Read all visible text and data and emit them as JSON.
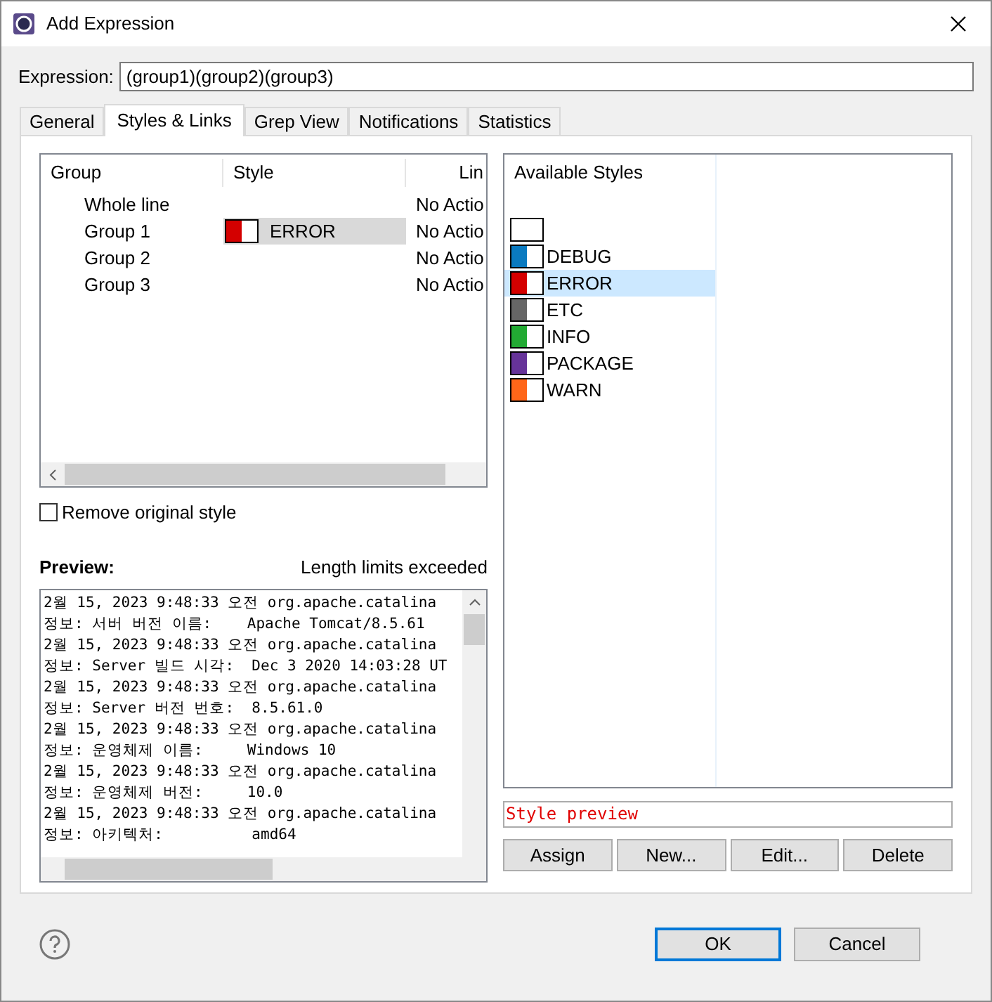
{
  "window": {
    "title": "Add Expression"
  },
  "expression": {
    "label": "Expression:",
    "value": "(group1)(group2)(group3)"
  },
  "tabs": [
    {
      "label": "General",
      "selected": false
    },
    {
      "label": "Styles & Links",
      "selected": true
    },
    {
      "label": "Grep View",
      "selected": false
    },
    {
      "label": "Notifications",
      "selected": false
    },
    {
      "label": "Statistics",
      "selected": false
    }
  ],
  "groups_table": {
    "columns": [
      "Group",
      "Style",
      "Lin"
    ],
    "rows": [
      {
        "group": "Whole line",
        "column_3": "No Actio",
        "selected": false
      },
      {
        "group": "Group 1",
        "style": {
          "name": "ERROR",
          "color": "#d40000"
        },
        "column_3": "No Actio",
        "selected": true
      },
      {
        "group": "Group 2",
        "column_3": "No Actio",
        "selected": false
      },
      {
        "group": "Group 3",
        "column_3": "No Actio",
        "selected": false
      }
    ]
  },
  "remove_original_style": {
    "label": "Remove original style",
    "checked": false
  },
  "preview": {
    "label": "Preview:",
    "status": "Length limits exceeded",
    "lines": [
      "2월 15, 2023 9:48:33 오전 org.apache.catalina",
      "정보: 서버 버전 이름:    Apache Tomcat/8.5.61",
      "2월 15, 2023 9:48:33 오전 org.apache.catalina",
      "정보: Server 빌드 시각:  Dec 3 2020 14:03:28 UT",
      "2월 15, 2023 9:48:33 오전 org.apache.catalina",
      "정보: Server 버전 번호:  8.5.61.0",
      "2월 15, 2023 9:48:33 오전 org.apache.catalina",
      "정보: 운영체제 이름:     Windows 10",
      "2월 15, 2023 9:48:33 오전 org.apache.catalina",
      "정보: 운영체제 버전:     10.0",
      "2월 15, 2023 9:48:33 오전 org.apache.catalina",
      "정보: 아키텍처:          amd64"
    ]
  },
  "available_styles": {
    "title": "Available Styles",
    "items": [
      {
        "kind": "blank",
        "selected": false
      },
      {
        "kind": "color",
        "name": "DEBUG",
        "color": "#0a7ac0",
        "selected": false
      },
      {
        "kind": "color",
        "name": "ERROR",
        "color": "#d40000",
        "selected": true
      },
      {
        "kind": "color",
        "name": "ETC",
        "color": "#666666",
        "selected": false
      },
      {
        "kind": "color",
        "name": "INFO",
        "color": "#22aa33",
        "selected": false
      },
      {
        "kind": "color",
        "name": "PACKAGE",
        "color": "#663399",
        "selected": false
      },
      {
        "kind": "color",
        "name": "WARN",
        "color": "#ff6619",
        "selected": false
      }
    ]
  },
  "style_preview": {
    "text": "Style preview"
  },
  "style_buttons": [
    "Assign",
    "New...",
    "Edit...",
    "Delete"
  ],
  "dialog_buttons": [
    {
      "label": "OK",
      "default": true
    },
    {
      "label": "Cancel",
      "default": false
    }
  ]
}
